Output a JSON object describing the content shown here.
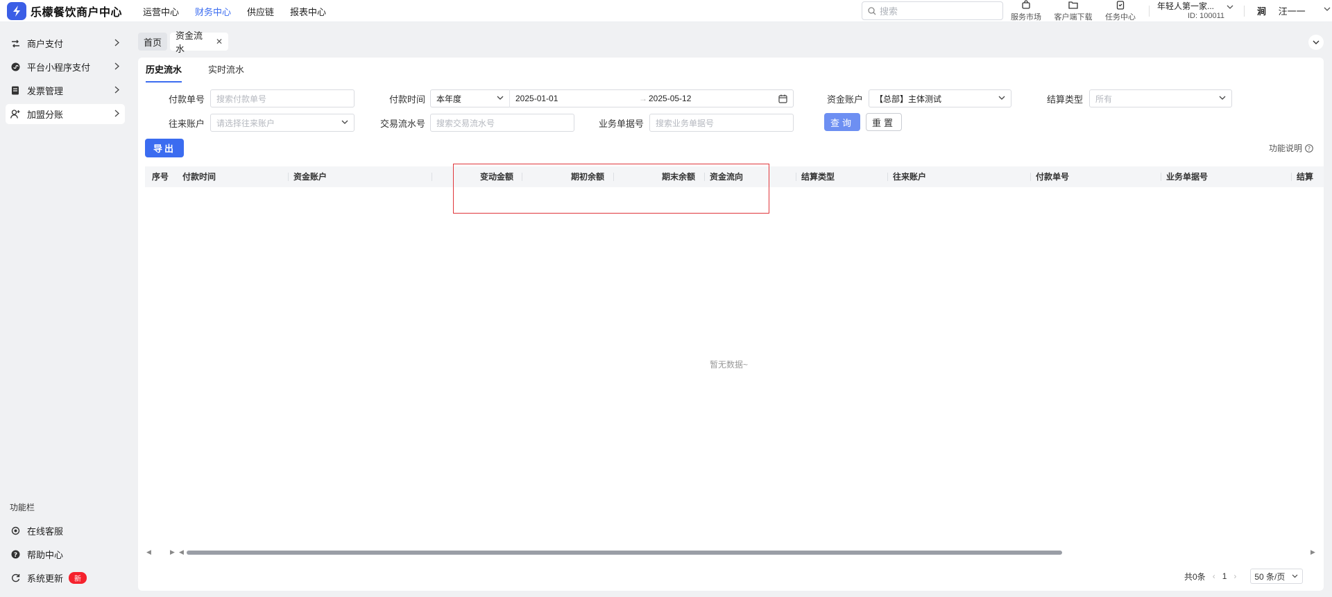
{
  "app": {
    "title": "乐檬餐饮商户中心",
    "logo_char": "⚡"
  },
  "topnav": {
    "items": [
      "运营中心",
      "财务中心",
      "供应链",
      "报表中心"
    ],
    "active_index": 1
  },
  "header": {
    "search_placeholder": "搜索",
    "tools": [
      "服务市场",
      "客户端下载",
      "任务中心"
    ],
    "merchant_name": "年轻人第一家...",
    "merchant_id": "ID: 100011",
    "user_avatar": "涧",
    "user_name": "汪一一"
  },
  "sidebar": {
    "items": [
      {
        "label": "商户支付",
        "icon": "swap-icon"
      },
      {
        "label": "平台小程序支付",
        "icon": "miniprogram-icon"
      },
      {
        "label": "发票管理",
        "icon": "invoice-icon"
      },
      {
        "label": "加盟分账",
        "icon": "user-add-icon"
      }
    ],
    "active_index": 3,
    "section_title": "功能栏",
    "bottom_items": [
      {
        "label": "在线客服",
        "icon": "headset-icon"
      },
      {
        "label": "帮助中心",
        "icon": "help-icon"
      },
      {
        "label": "系统更新",
        "icon": "refresh-icon",
        "badge": "新"
      }
    ]
  },
  "page_tabs": {
    "home": "首页",
    "current": "资金流水"
  },
  "subtabs": [
    "历史流水",
    "实时流水"
  ],
  "filters": {
    "pay_no": {
      "label": "付款单号",
      "placeholder": "搜索付款单号"
    },
    "pay_time": {
      "label": "付款时间",
      "range": "本年度",
      "start": "2025-01-01",
      "end": "2025-05-12"
    },
    "fund_account": {
      "label": "资金账户",
      "value": "【总部】主体测试"
    },
    "settle_type": {
      "label": "结算类型",
      "placeholder": "所有"
    },
    "counter_account": {
      "label": "往来账户",
      "placeholder": "请选择往来账户"
    },
    "txn_no": {
      "label": "交易流水号",
      "placeholder": "搜索交易流水号"
    },
    "biz_no": {
      "label": "业务单据号",
      "placeholder": "搜索业务单据号"
    },
    "query_label": "查询",
    "reset_label": "重置"
  },
  "toolbar": {
    "export_label": "导出",
    "help_label": "功能说明"
  },
  "table": {
    "columns": [
      "序号",
      "付款时间",
      "资金账户",
      "变动金额",
      "期初余额",
      "期末余额",
      "资金流向",
      "结算类型",
      "往来账户",
      "付款单号",
      "业务单据号",
      "结算"
    ],
    "rows": [],
    "empty_text": "暂无数据~"
  },
  "pagination": {
    "total": "共0条",
    "current_page": "1",
    "page_size": "50 条/页"
  },
  "colors": {
    "accent": "#3b6cf0",
    "highlight_box": "#e0353a",
    "badge": "#f5222d"
  }
}
